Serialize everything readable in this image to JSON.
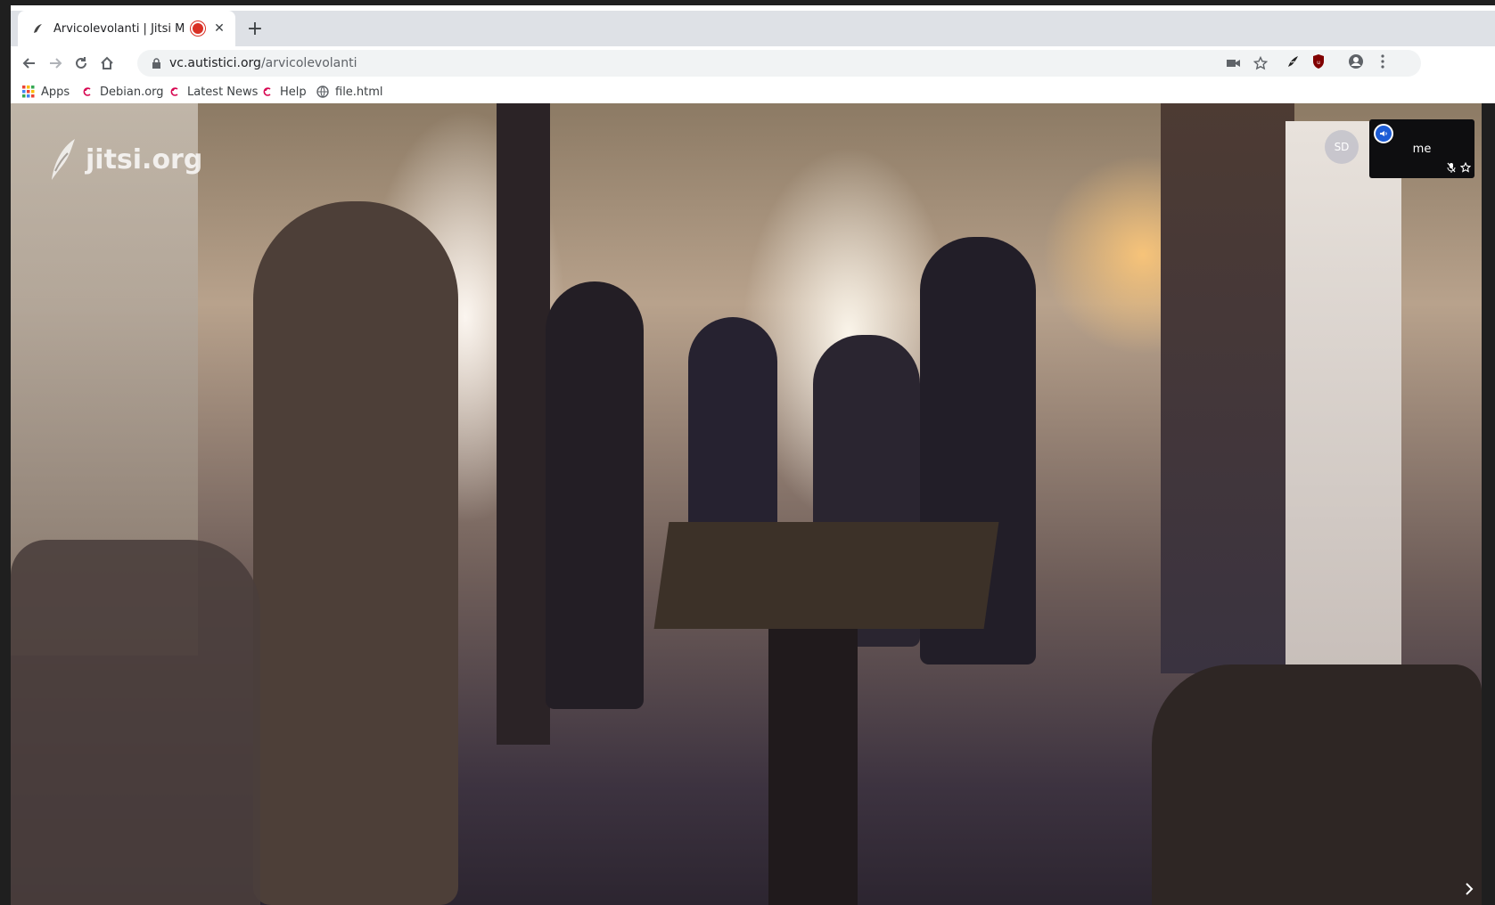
{
  "tab": {
    "title": "Arvicolevolanti | Jitsi Mee"
  },
  "address": {
    "host": "vc.autistici.org",
    "path": "/arvicolevolanti"
  },
  "bookmarks": [
    {
      "label": "Apps",
      "icon": "apps-grid-icon"
    },
    {
      "label": "Debian.org",
      "icon": "debian-icon"
    },
    {
      "label": "Latest News",
      "icon": "debian-icon"
    },
    {
      "label": "Help",
      "icon": "debian-icon"
    },
    {
      "label": "file.html",
      "icon": "globe-icon"
    }
  ],
  "video": {
    "watermark": "jitsi.org",
    "remote_avatar_initials": "SD",
    "local_label": "me"
  },
  "colors": {
    "recording": "#d93025",
    "debian": "#d70751",
    "jitsi_blue": "#1c5cd6",
    "ublock": "#800000"
  }
}
